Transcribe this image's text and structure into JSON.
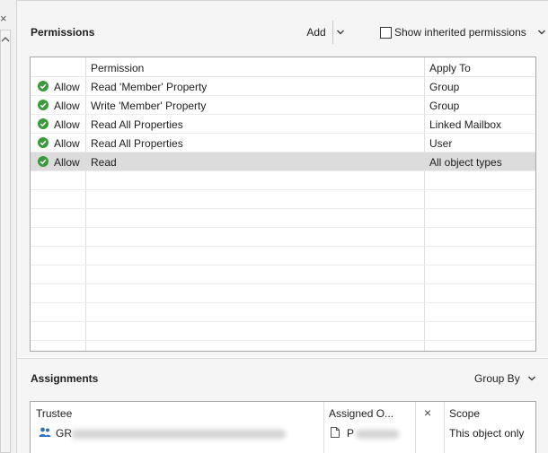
{
  "left_strip": {
    "close_icon": "close-icon"
  },
  "permissions": {
    "title": "Permissions",
    "add_label": "Add",
    "show_inherited_label": "Show inherited permissions",
    "show_inherited_checked": false,
    "columns": [
      "",
      "Permission",
      "Apply To"
    ],
    "rows": [
      {
        "type": "Allow",
        "permission": "Read 'Member' Property",
        "apply_to": "Group"
      },
      {
        "type": "Allow",
        "permission": "Write 'Member' Property",
        "apply_to": "Group"
      },
      {
        "type": "Allow",
        "permission": "Read All Properties",
        "apply_to": "Linked Mailbox"
      },
      {
        "type": "Allow",
        "permission": "Read All Properties",
        "apply_to": "User"
      },
      {
        "type": "Allow",
        "permission": "Read",
        "apply_to": "All object types",
        "selected": true
      }
    ]
  },
  "assignments": {
    "title": "Assignments",
    "group_by_label": "Group By",
    "columns": {
      "trustee": "Trustee",
      "assigned_on": "Assigned O...",
      "scope": "Scope"
    },
    "rows": [
      {
        "trustee": "GR",
        "assigned_on": "P",
        "scope": "This object only"
      }
    ]
  },
  "colors": {
    "allow_green": "#3c9a3c",
    "selected_row": "#dcdcdc",
    "group_icon": "#2f6fbf"
  }
}
